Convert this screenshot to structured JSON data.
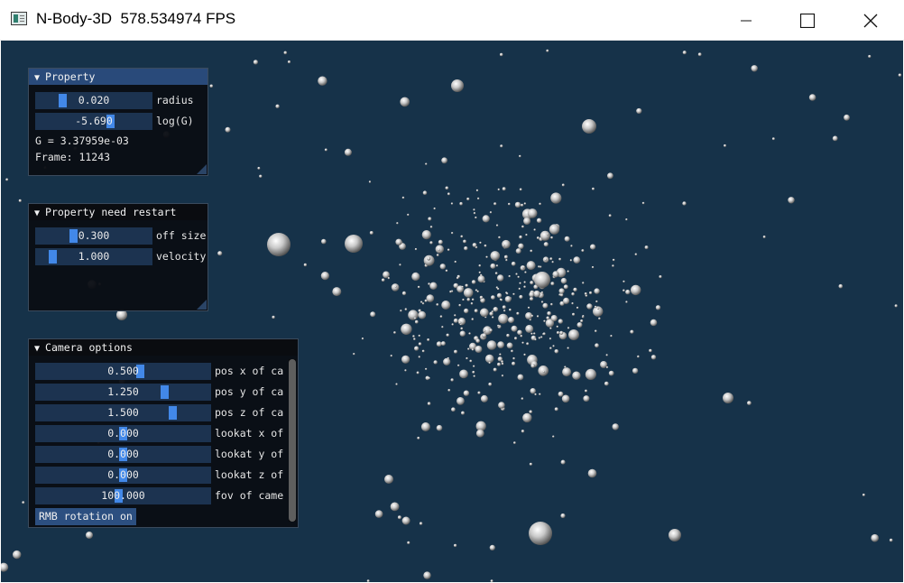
{
  "window": {
    "title": "N-Body-3D  578.534974 FPS",
    "colors": {
      "background": "#163249",
      "panel": "#0a0e14",
      "header_active": "#294a7a",
      "slider_grab": "#4288e8"
    }
  },
  "panels": {
    "property": {
      "title": "Property",
      "radius": {
        "value": "0.020",
        "label": "radius"
      },
      "log_g": {
        "value": "-5.690",
        "label": "log(G)"
      },
      "g_text": "G = 3.37959e-03",
      "frame_text": "Frame: 11243"
    },
    "restart": {
      "title": "Property need restart",
      "off_size": {
        "value": "0.300",
        "label": "off size"
      },
      "velocity": {
        "value": "1.000",
        "label": "velocity"
      }
    },
    "camera": {
      "title": "Camera options",
      "sliders": [
        {
          "value": "0.500",
          "label": "pos x of ca"
        },
        {
          "value": "1.250",
          "label": "pos y of ca"
        },
        {
          "value": "1.500",
          "label": "pos z of ca"
        },
        {
          "value": "0.000",
          "label": "lookat x of"
        },
        {
          "value": "0.000",
          "label": "lookat y of"
        },
        {
          "value": "0.000",
          "label": "lookat z of"
        },
        {
          "value": "100.000",
          "label": "fov of came"
        }
      ],
      "rmb_button": "RMB rotation on"
    }
  }
}
